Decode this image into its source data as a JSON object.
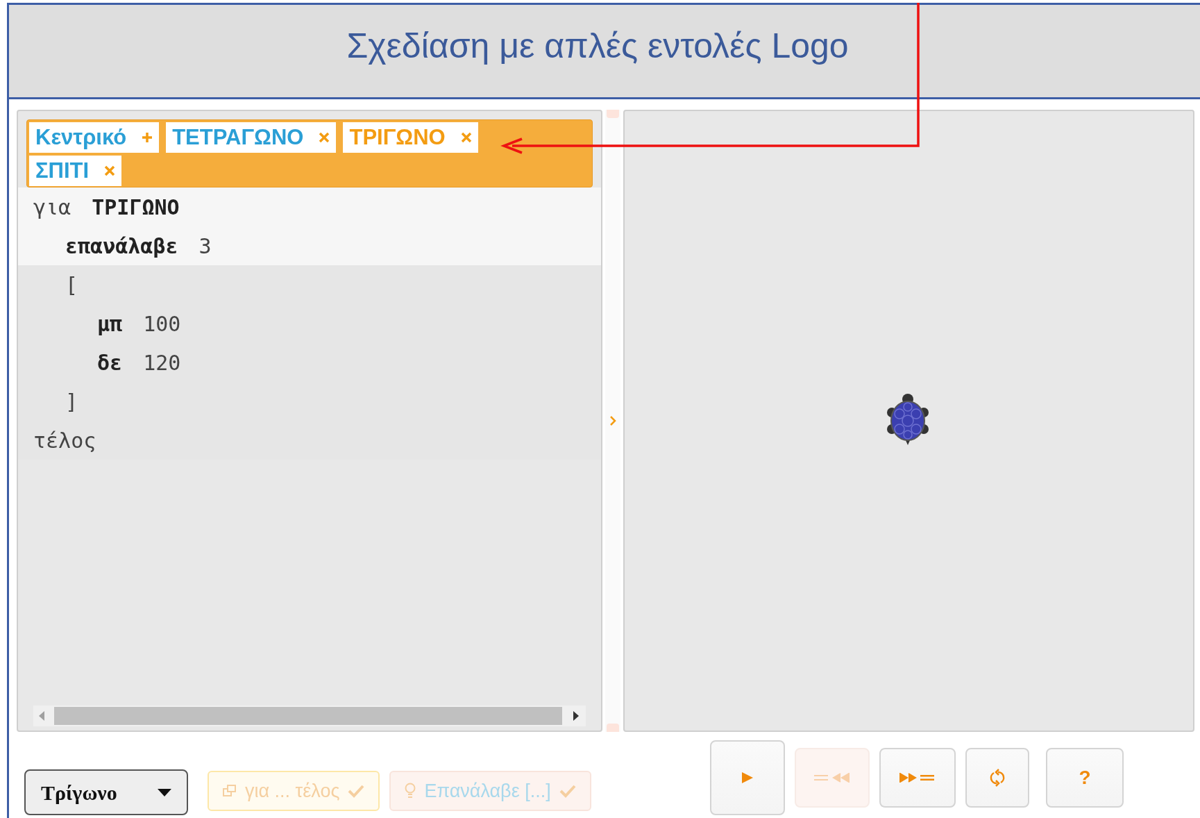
{
  "title": "Σχεδίαση με απλές εντολές Logo",
  "tabs": [
    {
      "label": "Κεντρικό",
      "kind": "main",
      "selected": false
    },
    {
      "label": "ΤΕΤΡΑΓΩΝΟ",
      "kind": "procedure",
      "selected": false
    },
    {
      "label": "ΤΡΙΓΩΝΟ",
      "kind": "procedure",
      "selected": true
    },
    {
      "label": "ΣΠΙΤΙ",
      "kind": "procedure",
      "selected": false
    }
  ],
  "code": [
    {
      "parts": [
        {
          "text": "για",
          "bold": false
        },
        {
          "text": "ΤΡΙΓΩΝΟ",
          "bold": true
        }
      ],
      "highlighted": true,
      "children": [
        {
          "parts": [
            {
              "text": "επανάλαβε",
              "bold": true
            },
            {
              "text": "3",
              "bold": false
            }
          ],
          "highlighted": true
        },
        {
          "parts": [
            {
              "text": "[",
              "bold": false
            }
          ],
          "highlighted": false,
          "children": [
            {
              "parts": [
                {
                  "text": "μπ",
                  "bold": true
                },
                {
                  "text": "100",
                  "bold": false
                }
              ],
              "highlighted": false
            },
            {
              "parts": [
                {
                  "text": "δε",
                  "bold": true
                },
                {
                  "text": "120",
                  "bold": false
                }
              ],
              "highlighted": false
            }
          ]
        },
        {
          "parts": [
            {
              "text": "]",
              "bold": false
            }
          ],
          "highlighted": false
        }
      ]
    },
    {
      "parts": [
        {
          "text": "τέλος",
          "bold": false
        }
      ],
      "highlighted": false
    }
  ],
  "example_select": {
    "value": "Τρίγωνο"
  },
  "hints": [
    {
      "kind": "procedure",
      "label": "για ... τέλος",
      "disabled": true
    },
    {
      "kind": "repeat",
      "label": "Επανάλαβε [...]",
      "disabled": true
    }
  ],
  "controls": [
    {
      "kind": "run",
      "disabled": false
    },
    {
      "kind": "back",
      "disabled": true
    },
    {
      "kind": "step",
      "disabled": false
    },
    {
      "kind": "reset",
      "disabled": false
    },
    {
      "kind": "help",
      "label": "?",
      "disabled": false
    }
  ]
}
